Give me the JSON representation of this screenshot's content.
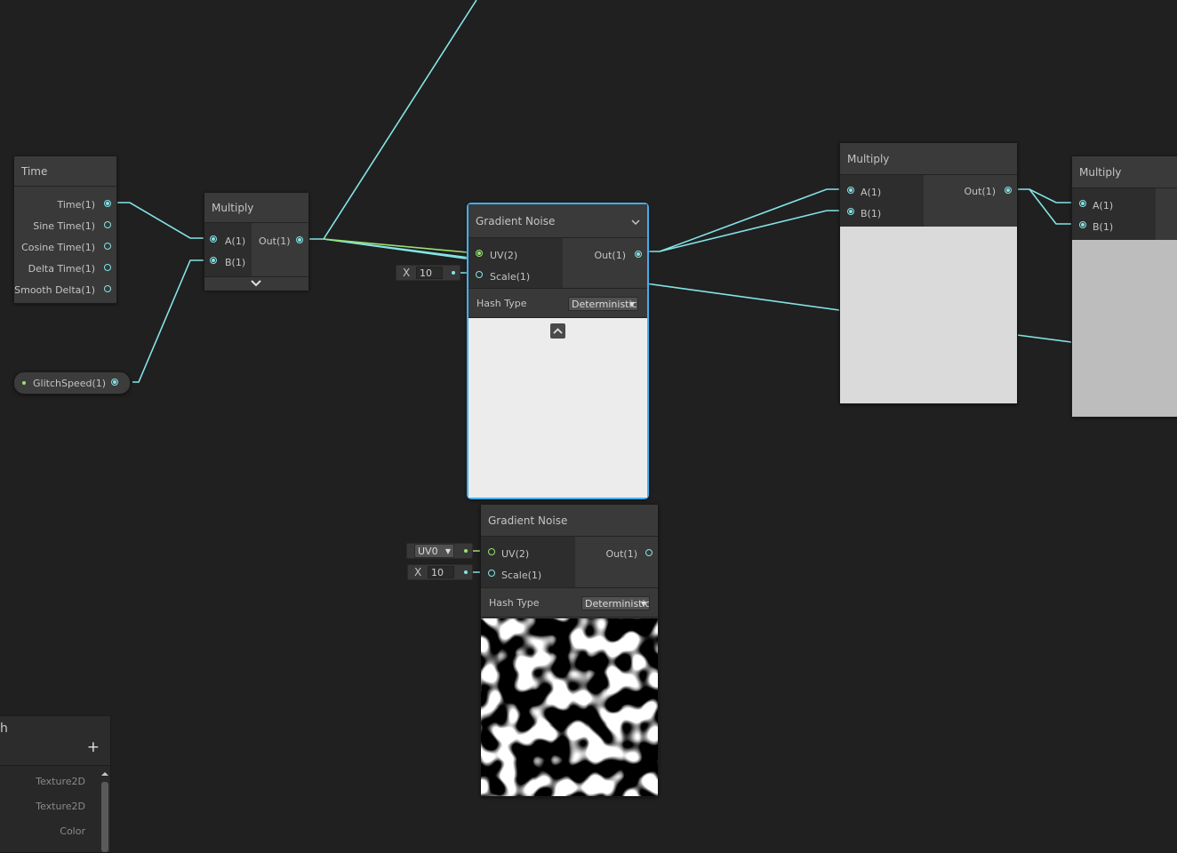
{
  "colors": {
    "wire": "#84e4e7",
    "wire_green": "#9ae070",
    "selection": "#44aef0",
    "canvas": "#202020"
  },
  "time_node": {
    "title": "Time",
    "outputs": [
      "Time(1)",
      "Sine Time(1)",
      "Cosine Time(1)",
      "Delta Time(1)",
      "Smooth Delta(1)"
    ]
  },
  "property_node": {
    "label": "GlitchSpeed(1)"
  },
  "multiply_1": {
    "title": "Multiply",
    "input_a": "A(1)",
    "input_b": "B(1)",
    "output": "Out(1)"
  },
  "gradient_noise_1": {
    "title": "Gradient Noise",
    "uv": "UV(2)",
    "scale": "Scale(1)",
    "output": "Out(1)",
    "hash_label": "Hash Type",
    "hash_value": "Deterministic",
    "scale_axis": "X",
    "scale_value": "10"
  },
  "gradient_noise_2": {
    "title": "Gradient Noise",
    "uv": "UV(2)",
    "scale": "Scale(1)",
    "output": "Out(1)",
    "hash_label": "Hash Type",
    "hash_value": "Deterministic",
    "uv_value": "UV0",
    "scale_axis": "X",
    "scale_value": "10"
  },
  "multiply_2": {
    "title": "Multiply",
    "input_a": "A(1)",
    "input_b": "B(1)",
    "output": "Out(1)"
  },
  "multiply_3": {
    "title": "Multiply",
    "input_a": "A(1)",
    "input_b": "B(1)"
  },
  "blackboard": {
    "title_fragment": "h",
    "add_label": "+",
    "types": [
      "Texture2D",
      "Texture2D",
      "Color"
    ]
  }
}
